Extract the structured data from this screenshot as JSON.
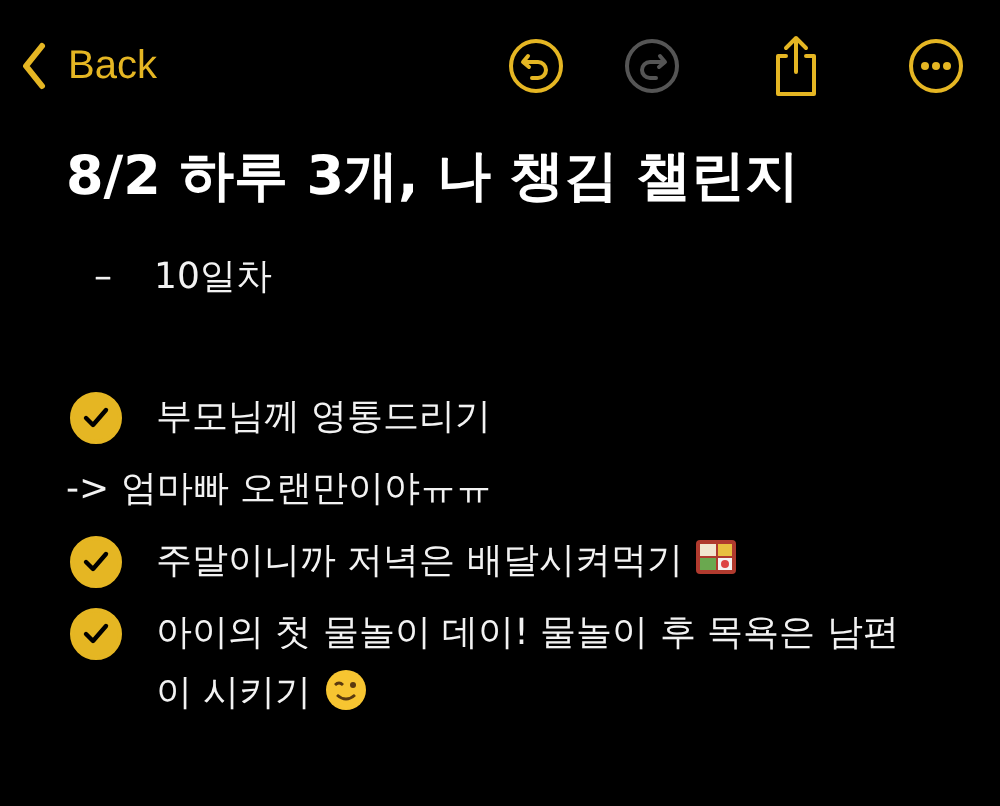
{
  "toolbar": {
    "back": {
      "label": "Back"
    },
    "buttons": [
      {
        "kind": "undo",
        "disabled": false
      },
      {
        "kind": "redo",
        "disabled": true
      },
      {
        "kind": "share",
        "disabled": false
      },
      {
        "kind": "more",
        "disabled": false
      }
    ]
  },
  "note": {
    "title": "8/2 하루 3개, 나 챙김 챌린지",
    "lines": [
      {
        "kind": "dash",
        "bullet": "–",
        "text": "10일차"
      },
      {
        "kind": "blank"
      },
      {
        "kind": "check",
        "checked": true,
        "text": "부모님께 영통드리기"
      },
      {
        "kind": "text",
        "text": "-> 엄마빠 오랜만이야ㅠㅠ"
      },
      {
        "kind": "check",
        "checked": true,
        "text": "주말이니까 저녁은 배달시켜먹기"
      },
      {
        "kind": "check",
        "checked": true,
        "text": "아이의 첫 물놀이 데이! 물놀이 후 목욕은 남편이 시키기"
      }
    ]
  }
}
